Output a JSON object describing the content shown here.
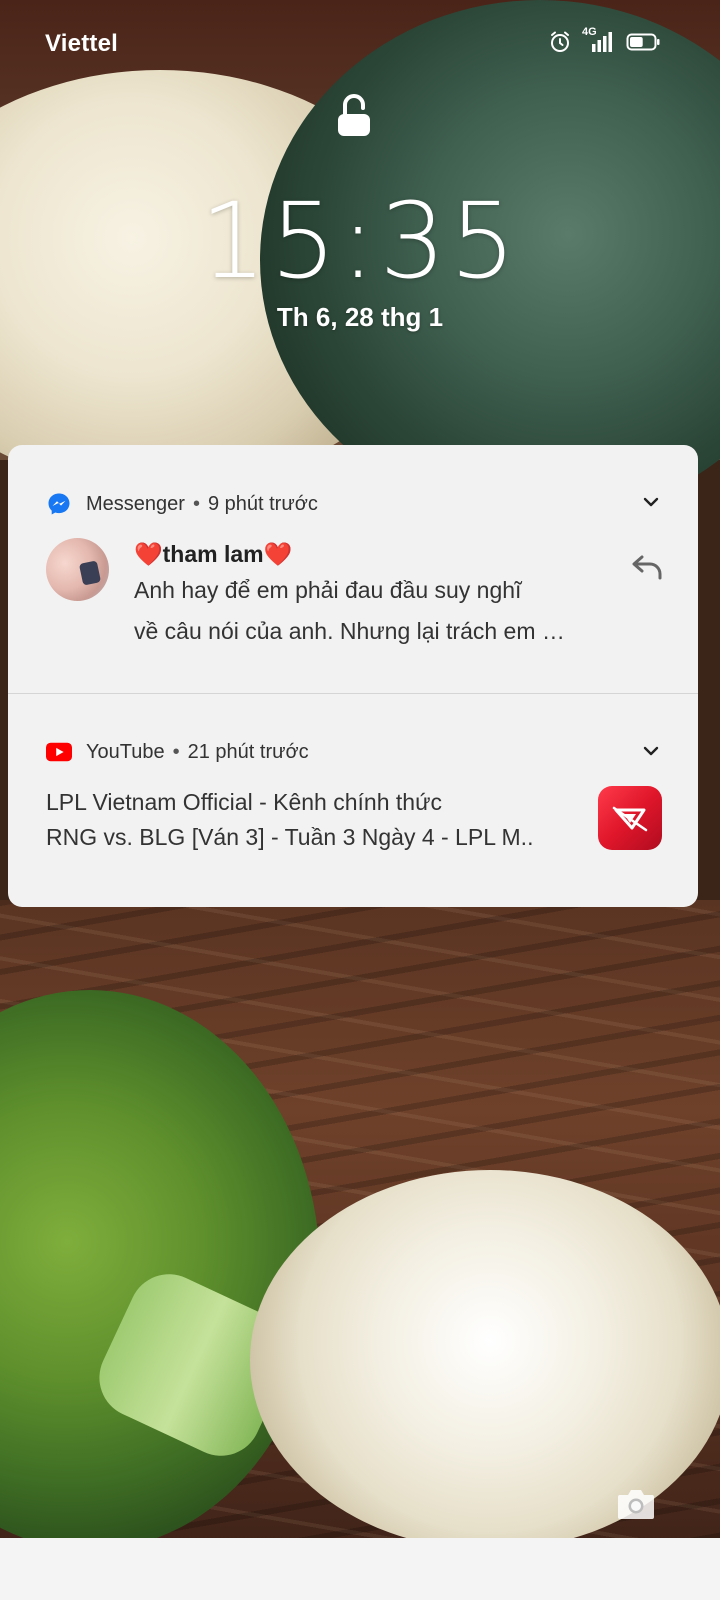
{
  "status_bar": {
    "carrier": "Viettel",
    "icons": [
      "alarm-icon",
      "mobile-signal-4g-icon",
      "battery-icon"
    ],
    "network_type": "4G",
    "battery_level": 0.55
  },
  "lock_screen": {
    "lock_icon": "padlock-unlocked-icon",
    "time": "15:35",
    "date": "Th 6, 28 thg 1"
  },
  "notifications": [
    {
      "app": "Messenger",
      "app_icon": "messenger-icon",
      "time_ago": "9 phút trước",
      "sender": "❤️tham lam❤️",
      "message_line_1": "Anh hay để em phải đau đầu suy nghĩ",
      "message_line_2": "về câu nói của anh. Nhưng lại trách em …",
      "action_icon": "reply-icon"
    },
    {
      "app": "YouTube",
      "app_icon": "youtube-icon",
      "time_ago": "21 phút trước",
      "title": "LPL Vietnam Official - Kênh chính thức",
      "text": "RNG vs. BLG [Ván 3] - Tuần 3 Ngày 4 - LPL M..",
      "thumbnail_icon": "lpl-logo-icon"
    }
  ],
  "bottom": {
    "camera_icon": "camera-icon"
  },
  "colors": {
    "panel_bg": "#f2f2f2",
    "messenger_blue": "#1877f2",
    "youtube_red": "#ff0000",
    "lpl_red": "#e0162b"
  }
}
